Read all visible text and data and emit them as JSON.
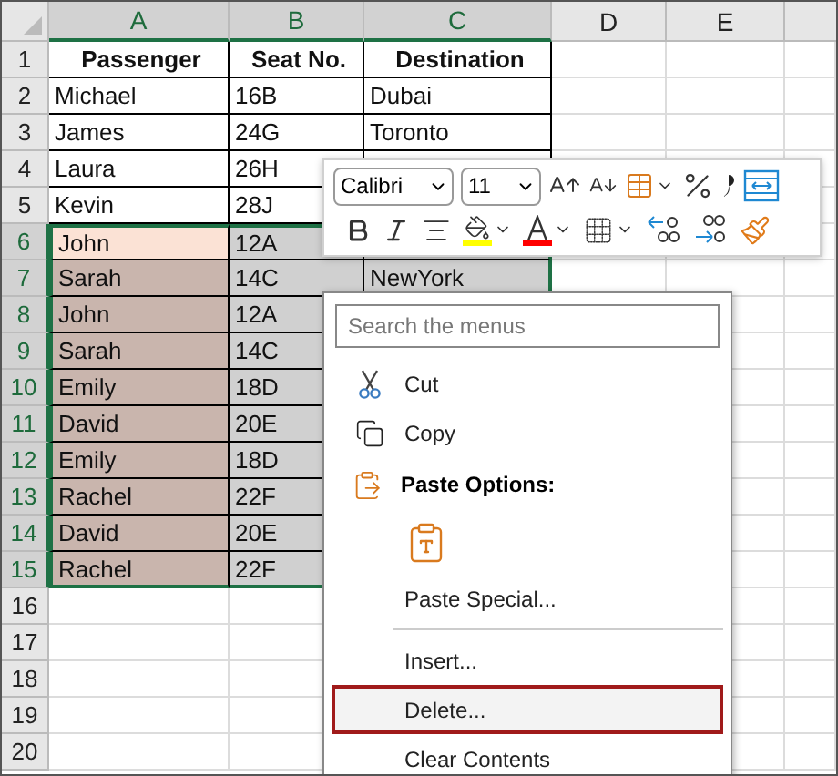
{
  "columns": [
    {
      "label": "A",
      "selected": true
    },
    {
      "label": "B",
      "selected": true
    },
    {
      "label": "C",
      "selected": true
    },
    {
      "label": "D",
      "selected": false
    },
    {
      "label": "E",
      "selected": false
    }
  ],
  "rows": [
    {
      "number": "1",
      "kind": "header",
      "selected": false,
      "cells": [
        "Passenger",
        "Seat No.",
        "Destination"
      ]
    },
    {
      "number": "2",
      "kind": "data",
      "selected": false,
      "cells": [
        "Michael",
        "16B",
        "Dubai"
      ]
    },
    {
      "number": "3",
      "kind": "data",
      "selected": false,
      "cells": [
        "James",
        "24G",
        "Toronto"
      ]
    },
    {
      "number": "4",
      "kind": "data",
      "selected": false,
      "cells": [
        "Laura",
        "26H"
      ]
    },
    {
      "number": "5",
      "kind": "data",
      "selected": false,
      "cells": [
        "Kevin",
        "28J"
      ]
    },
    {
      "number": "6",
      "kind": "data",
      "selected": true,
      "active": true,
      "cells": [
        "John",
        "12A"
      ]
    },
    {
      "number": "7",
      "kind": "data",
      "selected": true,
      "cells": [
        "Sarah",
        "14C",
        "NewYork"
      ]
    },
    {
      "number": "8",
      "kind": "data",
      "selected": true,
      "cells": [
        "John",
        "12A"
      ]
    },
    {
      "number": "9",
      "kind": "data",
      "selected": true,
      "cells": [
        "Sarah",
        "14C"
      ]
    },
    {
      "number": "10",
      "kind": "data",
      "selected": true,
      "cells": [
        "Emily",
        "18D"
      ]
    },
    {
      "number": "11",
      "kind": "data",
      "selected": true,
      "cells": [
        "David",
        "20E"
      ]
    },
    {
      "number": "12",
      "kind": "data",
      "selected": true,
      "cells": [
        "Emily",
        "18D"
      ]
    },
    {
      "number": "13",
      "kind": "data",
      "selected": true,
      "cells": [
        "Rachel",
        "22F"
      ]
    },
    {
      "number": "14",
      "kind": "data",
      "selected": true,
      "cells": [
        "David",
        "20E"
      ]
    },
    {
      "number": "15",
      "kind": "data",
      "selected": true,
      "cells": [
        "Rachel",
        "22F"
      ]
    },
    {
      "number": "16",
      "kind": "empty",
      "selected": false
    },
    {
      "number": "17",
      "kind": "empty",
      "selected": false
    },
    {
      "number": "18",
      "kind": "empty",
      "selected": false
    },
    {
      "number": "19",
      "kind": "empty",
      "selected": false
    },
    {
      "number": "20",
      "kind": "empty",
      "selected": false
    }
  ],
  "mini_toolbar": {
    "font": "Calibri",
    "size": "11",
    "row_1": [
      {
        "kind": "grow-font"
      },
      {
        "kind": "shrink-font"
      },
      {
        "kind": "cell-format",
        "dropdown": true
      },
      {
        "kind": "percent"
      },
      {
        "kind": "comma"
      },
      {
        "kind": "wrap"
      }
    ],
    "row_2": [
      {
        "kind": "bold"
      },
      {
        "kind": "italic"
      },
      {
        "kind": "align"
      },
      {
        "kind": "fill-color",
        "dropdown": true,
        "color": "#ffff00"
      },
      {
        "kind": "font-color",
        "dropdown": true,
        "color": "#ff0000"
      },
      {
        "kind": "borders",
        "dropdown": true
      },
      {
        "kind": "decrease-decimal"
      },
      {
        "kind": "increase-decimal"
      },
      {
        "kind": "format-painter"
      }
    ]
  },
  "context_menu": {
    "search": {
      "placeholder": "Search the menus"
    },
    "items": [
      {
        "kind": "cut",
        "label": "Cut",
        "selected": false
      },
      {
        "kind": "copy",
        "label": "Copy",
        "selected": false
      },
      {
        "kind": "heading",
        "label": "Paste Options:"
      },
      {
        "kind": "paste-option",
        "selected": false
      },
      {
        "kind": "command",
        "label": "Paste Special...",
        "selected": false
      },
      {
        "kind": "separator"
      },
      {
        "kind": "command",
        "label": "Insert...",
        "selected": false
      },
      {
        "kind": "command",
        "label": "Delete...",
        "selected": true
      },
      {
        "kind": "command",
        "label": "Clear Contents",
        "selected": false
      }
    ]
  }
}
